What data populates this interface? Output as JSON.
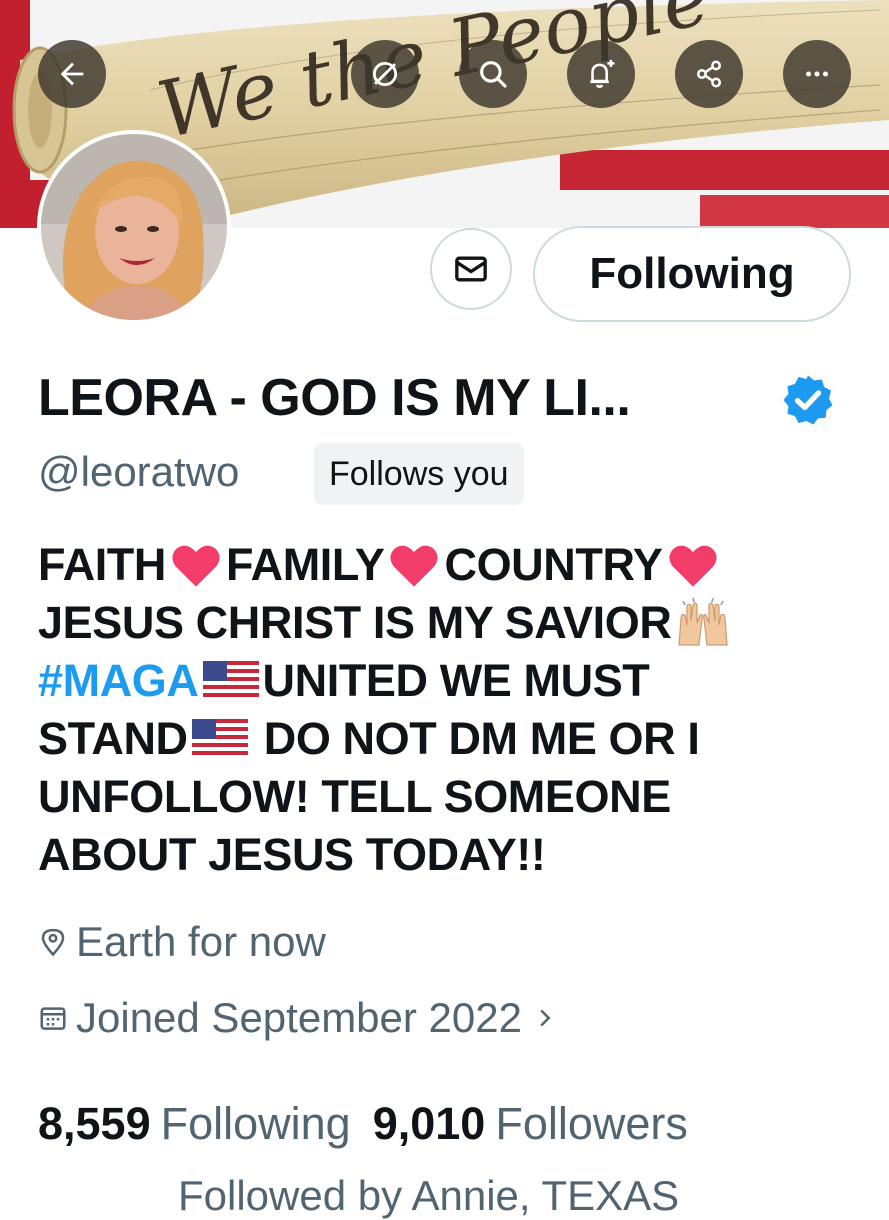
{
  "banner": {
    "scroll_text": "We the People"
  },
  "top_bar": {
    "buttons": [
      {
        "name": "back-arrow-icon"
      },
      {
        "name": "grok-icon"
      },
      {
        "name": "search-icon"
      },
      {
        "name": "bell-plus-icon"
      },
      {
        "name": "share-icon"
      },
      {
        "name": "more-icon"
      }
    ]
  },
  "actions": {
    "follow_label": "Following"
  },
  "profile": {
    "name": "LEORA - GOD IS MY LI...",
    "handle": "@leoratwo",
    "follows_you": "Follows you",
    "bio": {
      "l1a": "FAITH ",
      "l1b": "FAMILY",
      "l1c": "COUNTRY",
      "l2": "JESUS CHRIST IS MY SAVIOR ",
      "l3_hashtag": "#MAGA",
      "l3_rest": "UNITED WE MUST",
      "l4a": "STAND",
      "l4b": " DO NOT DM ME OR I",
      "l5": "UNFOLLOW! TELL SOMEONE",
      "l6": "ABOUT JESUS TODAY!!"
    },
    "location": "Earth for now",
    "joined": "Joined September 2022",
    "following_count": "8,559",
    "following_label": "Following",
    "followers_count": "9,010",
    "followers_label": "Followers",
    "followed_by": "Followed by Annie, TEXAS"
  },
  "colors": {
    "accent": "#1d9bf0",
    "secondary_text": "#536471",
    "primary_text": "#0f1419",
    "border": "#cfd9de",
    "badge_bg": "#eff3f4"
  }
}
